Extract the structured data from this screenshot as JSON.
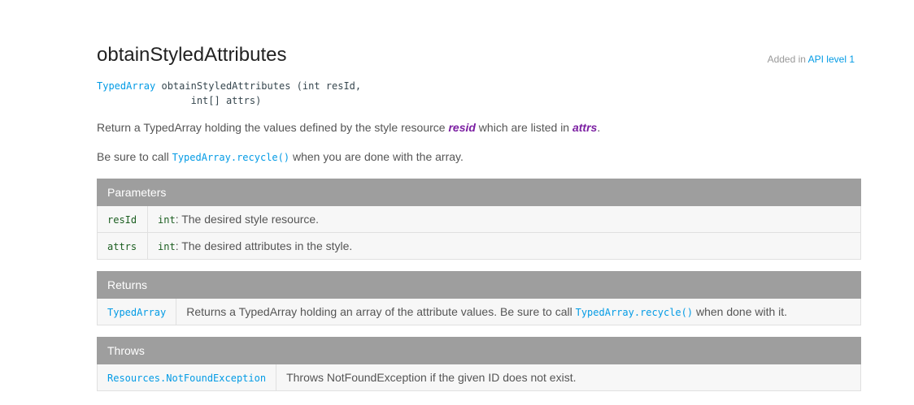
{
  "method": {
    "title": "obtainStyledAttributes",
    "added_prefix": "Added in ",
    "added_link": "API level 1",
    "sig_return_type": "TypedArray",
    "sig_line1": " obtainStyledAttributes (int resId,",
    "sig_line2": "                int[] attrs)",
    "desc1_a": "Return a TypedArray holding the values defined by the style resource ",
    "desc1_em1": "resid",
    "desc1_b": " which are listed in ",
    "desc1_em2": "attrs",
    "desc1_c": ".",
    "desc2_a": "Be sure to call ",
    "desc2_code": "TypedArray.recycle()",
    "desc2_b": " when you are done with the array."
  },
  "parameters": {
    "header": "Parameters",
    "rows": [
      {
        "name": "resId",
        "type": "int",
        "desc": ": The desired style resource."
      },
      {
        "name": "attrs",
        "type": "int",
        "desc": ": The desired attributes in the style."
      }
    ]
  },
  "returns": {
    "header": "Returns",
    "type": "TypedArray",
    "desc_a": "Returns a TypedArray holding an array of the attribute values. Be sure to call ",
    "desc_code": "TypedArray.recycle()",
    "desc_b": " when done with it."
  },
  "throws": {
    "header": "Throws",
    "type": "Resources.NotFoundException",
    "desc": "Throws NotFoundException if the given ID does not exist."
  }
}
